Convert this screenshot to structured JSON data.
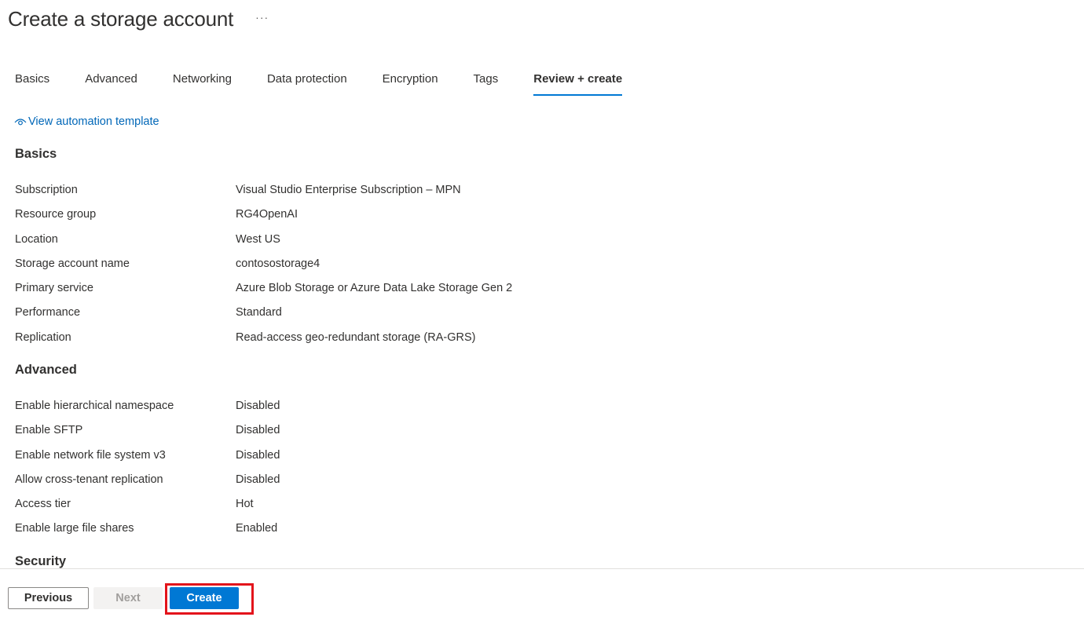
{
  "header": {
    "title": "Create a storage account",
    "more": "···"
  },
  "tabs": [
    {
      "label": "Basics"
    },
    {
      "label": "Advanced"
    },
    {
      "label": "Networking"
    },
    {
      "label": "Data protection"
    },
    {
      "label": "Encryption"
    },
    {
      "label": "Tags"
    },
    {
      "label": "Review + create",
      "active": true
    }
  ],
  "automation_link": "View automation template",
  "sections": {
    "basics": {
      "heading": "Basics",
      "rows": [
        {
          "key": "Subscription",
          "value": "Visual Studio Enterprise Subscription – MPN"
        },
        {
          "key": "Resource group",
          "value": "RG4OpenAI"
        },
        {
          "key": "Location",
          "value": "West US"
        },
        {
          "key": "Storage account name",
          "value": "contosostorage4"
        },
        {
          "key": "Primary service",
          "value": "Azure Blob Storage or Azure Data Lake Storage Gen 2"
        },
        {
          "key": "Performance",
          "value": "Standard"
        },
        {
          "key": "Replication",
          "value": "Read-access geo-redundant storage (RA-GRS)"
        }
      ]
    },
    "advanced": {
      "heading": "Advanced",
      "rows": [
        {
          "key": "Enable hierarchical namespace",
          "value": "Disabled"
        },
        {
          "key": "Enable SFTP",
          "value": "Disabled"
        },
        {
          "key": "Enable network file system v3",
          "value": "Disabled"
        },
        {
          "key": "Allow cross-tenant replication",
          "value": "Disabled"
        },
        {
          "key": "Access tier",
          "value": "Hot"
        },
        {
          "key": "Enable large file shares",
          "value": "Enabled"
        }
      ]
    },
    "security": {
      "heading": "Security"
    }
  },
  "footer": {
    "previous": "Previous",
    "next": "Next",
    "create": "Create"
  },
  "colors": {
    "accent": "#0078d4",
    "link": "#0067b8",
    "highlight": "#e3141b"
  }
}
